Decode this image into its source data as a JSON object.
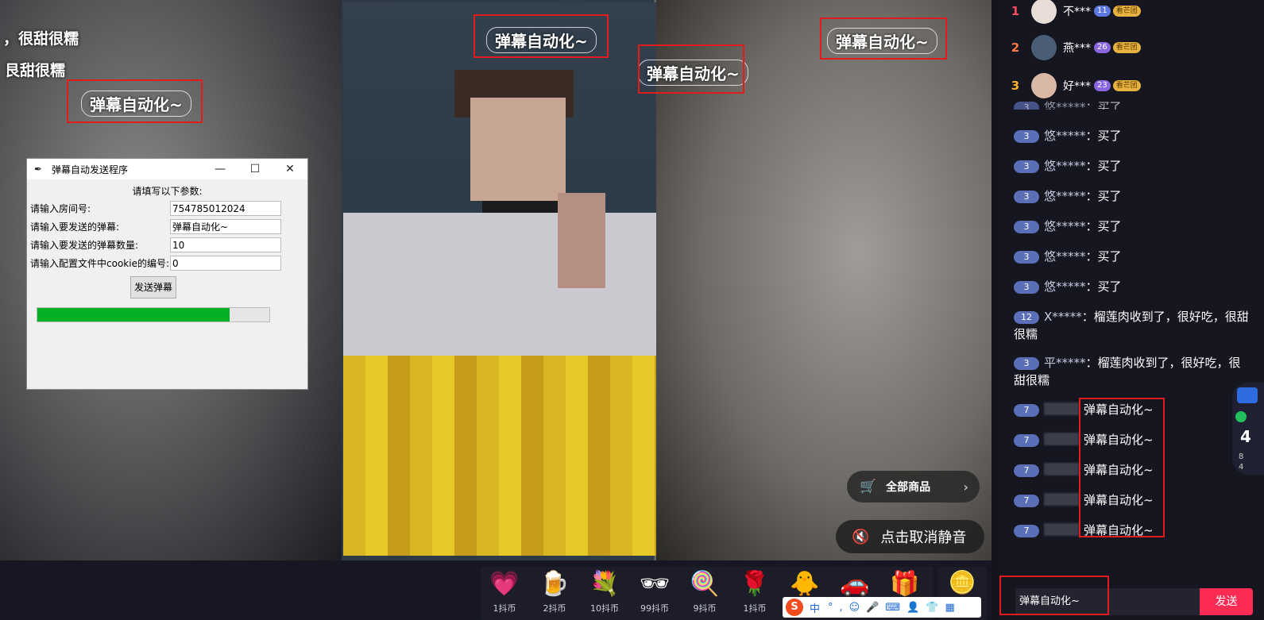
{
  "video": {
    "scroll_texts": [
      "，很甜很糯",
      "艮甜很糯"
    ],
    "danmu_text": "弹幕自动化~"
  },
  "tk_window": {
    "title": "弹幕自动发送程序",
    "heading": "请填写以下参数:",
    "fields": [
      {
        "label": "请输入房间号:",
        "value": "754785012024"
      },
      {
        "label": "请输入要发送的弹幕:",
        "value": "弹幕自动化~"
      },
      {
        "label": "请输入要发送的弹幕数量:",
        "value": "10"
      },
      {
        "label": "请输入配置文件中cookie的编号:",
        "value": "0"
      }
    ],
    "send_button": "发送弹幕",
    "progress_fraction": 0.83
  },
  "overlay": {
    "all_goods": "全部商品",
    "unmute": "点击取消静音"
  },
  "gifts": [
    {
      "icon": "heart-icon",
      "glyph": "💗",
      "price": "1抖币"
    },
    {
      "icon": "beer-icon",
      "glyph": "🍺",
      "price": "2抖币"
    },
    {
      "icon": "bouquet-icon",
      "glyph": "💐",
      "price": "10抖币"
    },
    {
      "icon": "glasses-icon",
      "glyph": "🕶",
      "price": "99抖币"
    },
    {
      "icon": "lollipop-icon",
      "glyph": "🍭",
      "price": "9抖币"
    },
    {
      "icon": "rose-icon",
      "glyph": "🌹",
      "price": "1抖币"
    },
    {
      "icon": "duck-icon",
      "glyph": "🐥",
      "price": ""
    },
    {
      "icon": "car-icon",
      "glyph": "🚗",
      "price": ""
    },
    {
      "icon": "gift-box-icon",
      "glyph": "🎁",
      "price": ""
    }
  ],
  "recharge": {
    "label": "值"
  },
  "ime": {
    "logo": "S",
    "mode": "中"
  },
  "sidebar": {
    "ranks": [
      {
        "num": "1",
        "name": "不***",
        "level": "11",
        "fans": "看芒团"
      },
      {
        "num": "2",
        "name": "燕***",
        "level": "26",
        "fans": "看芒团"
      },
      {
        "num": "3",
        "name": "好***",
        "level": "23",
        "fans": "看芒团"
      }
    ],
    "partial_msg": {
      "badge": "3",
      "user": "悠*****",
      "text": "：买了"
    },
    "messages": [
      {
        "badge": "3",
        "user": "悠*****",
        "text": "：买了"
      },
      {
        "badge": "3",
        "user": "悠*****",
        "text": "：买了"
      },
      {
        "badge": "3",
        "user": "悠*****",
        "text": "：买了"
      },
      {
        "badge": "3",
        "user": "悠*****",
        "text": "：买了"
      },
      {
        "badge": "3",
        "user": "悠*****",
        "text": "：买了"
      },
      {
        "badge": "3",
        "user": "悠*****",
        "text": "：买了"
      }
    ],
    "long_messages": [
      {
        "badge": "12",
        "user": "X*****",
        "text": "：榴莲肉收到了，很好吃，很甜很糯"
      },
      {
        "badge": "3",
        "user": "平*****",
        "text": "：榴莲肉收到了，很好吃，很甜很糯"
      }
    ],
    "danmu_messages": [
      {
        "badge": "7",
        "text": "弹幕自动化~"
      },
      {
        "badge": "7",
        "text": "弹幕自动化~"
      },
      {
        "badge": "7",
        "text": "弹幕自动化~"
      },
      {
        "badge": "7",
        "text": "弹幕自动化~"
      },
      {
        "badge": "7",
        "text": "弹幕自动化~"
      }
    ],
    "widget": {
      "big": "4",
      "l1": "8",
      "l2": "4"
    },
    "input_value": "弹幕自动化~",
    "send_label": "发送"
  },
  "colors": {
    "accent": "#fe2c55",
    "annotation_red": "#e21c1c",
    "progress_green": "#06b025"
  }
}
